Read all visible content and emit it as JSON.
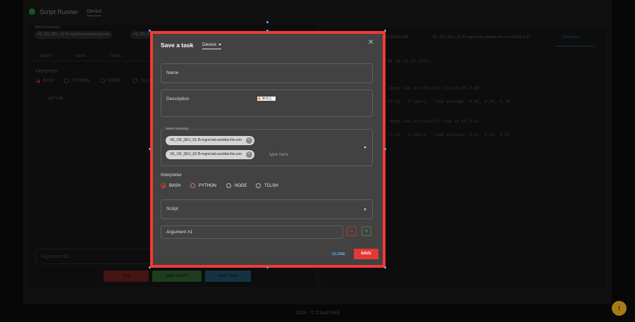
{
  "header": {
    "title": "Script Runner",
    "mode": "Device"
  },
  "background": {
    "select_label": "Select Device(s)",
    "chips": [
      "VE_CR_DEV_01.f5-mgmt.lab.worldtechit.com",
      "VE_CR_D"
    ],
    "tabs": [
      "SCRIPT",
      "REPO",
      "TASKS"
    ],
    "interpreter_label": "Interpreter",
    "interpreters": [
      "BASH",
      "PYTHON",
      "NODE",
      "TCLSH"
    ],
    "code_first_line": "uptime",
    "argument": "Argument #1",
    "buttons": {
      "run": "RUN",
      "save_script": "SAVE SCRIPT",
      "save_task": "SAVE TASK"
    },
    "right_tabs": [
      ".com:10.65.9.60",
      "VE_CR_DEV_02.f5-mgmt.lab.worldtechit.com:10.65.9.61",
      "Combined"
    ],
    "terminal": [
      "ME 18:18:29 (UTC)",
      "",
      "",
      "-mgmt.lab.worldtechit.com:10.65.9.60",
      "",
      "17:02,  0 users,  load average: 0.08, 0.16, 0.18",
      "",
      "",
      "-mgmt.lab.worldtechit.com:10.65.9.61 ---",
      "",
      "17:24,  0 users,  load average: 0.11, 0.42, 0.35"
    ]
  },
  "dialog": {
    "title": "Save a task",
    "mode": "Device",
    "name_label": "Name",
    "description_label": "Description",
    "devices_label": "Select Device(s)",
    "devices": [
      "VE_CR_DEV_01.f5-mgmt.lab.worldtechit.com",
      "VE_CR_DEV_02.f5-mgmt.lab.worldtechit.com"
    ],
    "devices_placeholder": "type here",
    "interpreter_label": "Interpreter",
    "interpreters": [
      "BASH",
      "PYTHON",
      "NODE",
      "TCLSH"
    ],
    "selected_interpreter": "BASH",
    "script_label": "Script",
    "argument_label": "Argument #1",
    "close": "CLOSE",
    "save": "SAVE"
  },
  "footer": {
    "text": "2024 · © Cloud.Red"
  },
  "colors": {
    "accent": "#e53935",
    "highlight_frame": "#f13a36",
    "link": "#64b5f6"
  }
}
